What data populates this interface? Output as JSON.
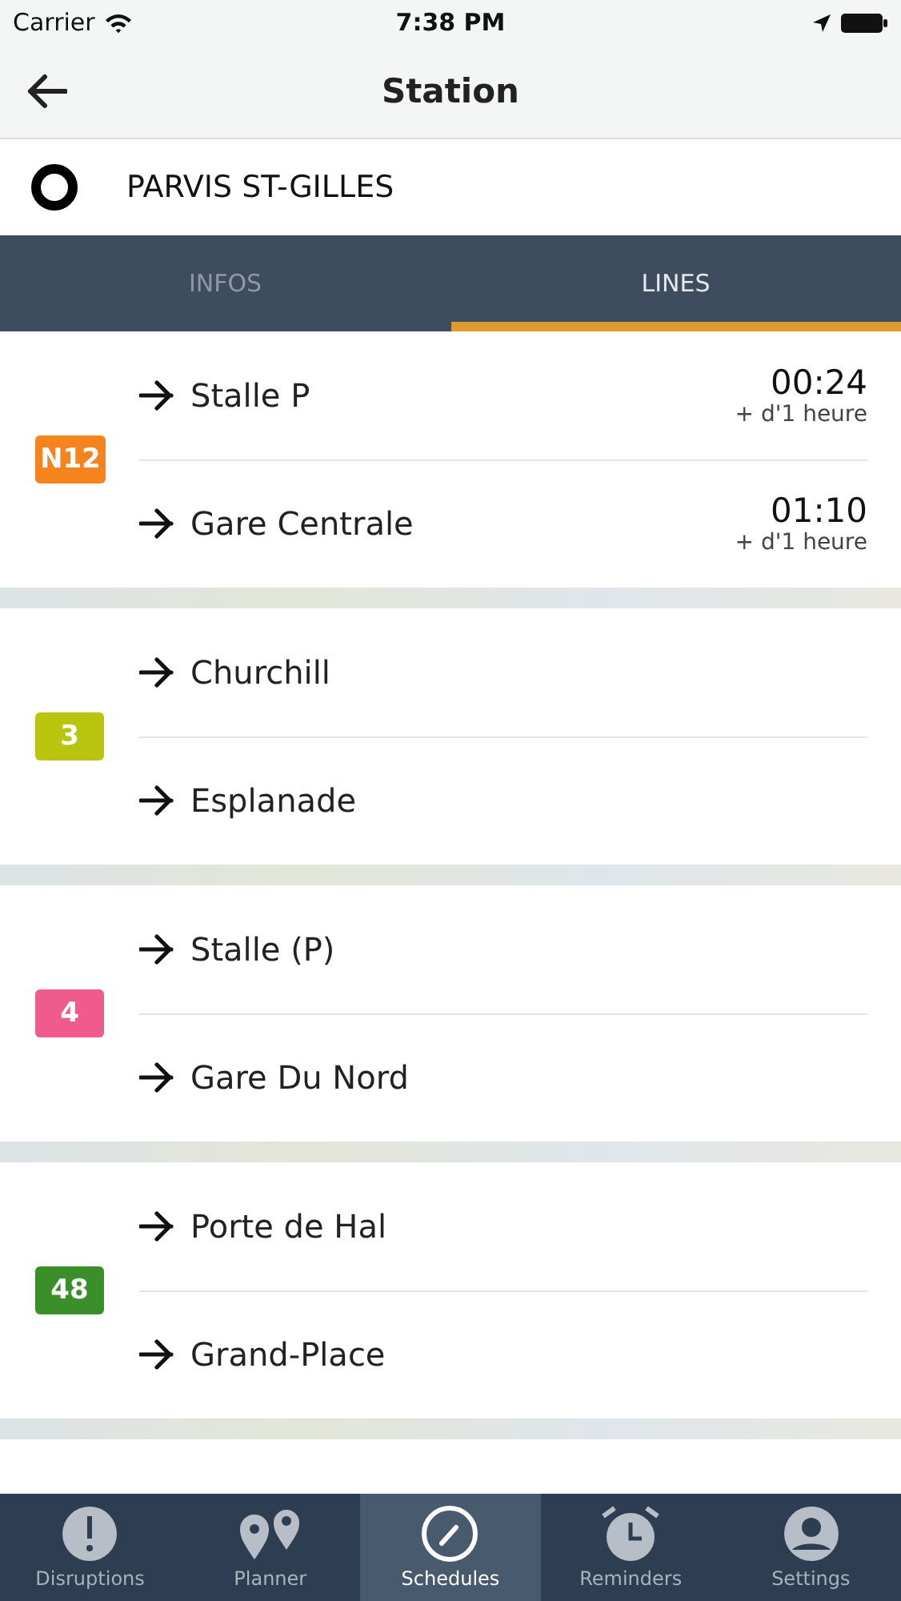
{
  "status_bar": {
    "carrier": "Carrier",
    "time": "7:38 PM"
  },
  "nav": {
    "title": "Station"
  },
  "station": {
    "name": "PARVIS ST-GILLES"
  },
  "tabs": [
    {
      "label": "INFOS",
      "selected": false
    },
    {
      "label": "LINES",
      "selected": true
    }
  ],
  "lines": [
    {
      "number": "N12",
      "color": "#f5841f",
      "directions": [
        {
          "destination": "Stalle P",
          "time": "00:24",
          "note": "+ d'1 heure"
        },
        {
          "destination": "Gare Centrale",
          "time": "01:10",
          "note": "+ d'1 heure"
        }
      ]
    },
    {
      "number": "3",
      "color": "#b9c40f",
      "directions": [
        {
          "destination": "Churchill"
        },
        {
          "destination": "Esplanade"
        }
      ]
    },
    {
      "number": "4",
      "color": "#ee5b8c",
      "directions": [
        {
          "destination": "Stalle (P)"
        },
        {
          "destination": "Gare Du Nord"
        }
      ]
    },
    {
      "number": "48",
      "color": "#3a8f2a",
      "directions": [
        {
          "destination": "Porte de Hal"
        },
        {
          "destination": "Grand-Place"
        }
      ]
    }
  ],
  "tab_bar": [
    {
      "label": "Disruptions",
      "kind": "alert",
      "selected": false
    },
    {
      "label": "Planner",
      "kind": "pins",
      "selected": false
    },
    {
      "label": "Schedules",
      "kind": "clock",
      "selected": true
    },
    {
      "label": "Reminders",
      "kind": "alarm",
      "selected": false
    },
    {
      "label": "Settings",
      "kind": "person",
      "selected": false
    }
  ]
}
